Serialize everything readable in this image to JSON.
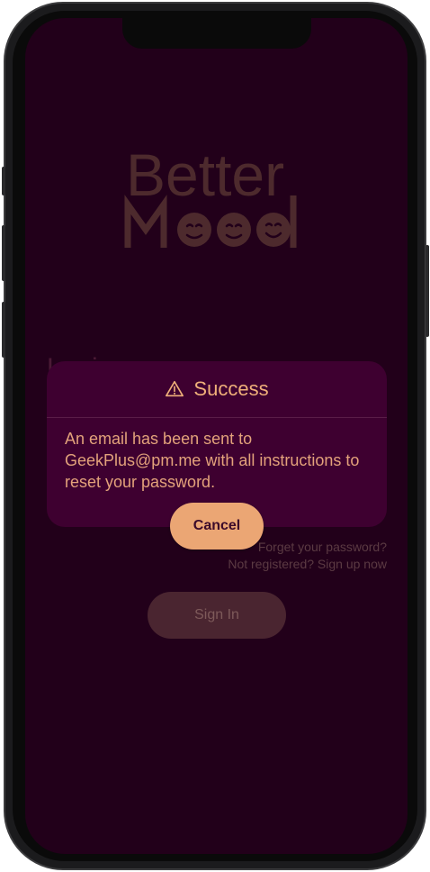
{
  "logo": {
    "word_top": "Better",
    "word_bottom": "Mood"
  },
  "background": {
    "faded_title": "Login",
    "forgot_password": "Forget your password?",
    "sign_up": "Not registered? Sign up now",
    "sign_in_label": "Sign In"
  },
  "dialog": {
    "icon": "warning-triangle-icon",
    "title": "Success",
    "message": "An email has been sent to GeekPlus@pm.me with all instructions to reset your password.",
    "cancel_label": "Cancel"
  },
  "colors": {
    "screen_bg": "#22001a",
    "dialog_bg": "#3e0030",
    "accent": "#eba674",
    "logo": "#4d2a2d"
  }
}
